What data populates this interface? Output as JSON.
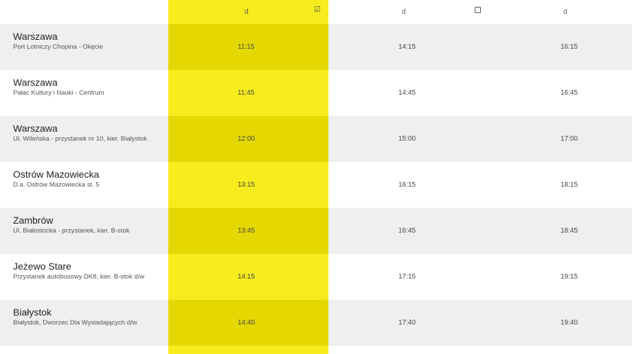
{
  "header": {
    "col1_label": "d",
    "col1_checked": "☑",
    "col2_label": "d",
    "col3_label": "d"
  },
  "stops": [
    {
      "name": "Warszawa",
      "detail": "Port Lotniczy Chopina - Okęcie",
      "times": [
        "11:15",
        "14:15",
        "16:15"
      ]
    },
    {
      "name": "Warszawa",
      "detail": "Pałac Kultury i Nauki - Centrum",
      "times": [
        "11:45",
        "14:45",
        "16:45"
      ]
    },
    {
      "name": "Warszawa",
      "detail": "Ul. Wileńska - przystanek nr 10, kier. Białystok",
      "times": [
        "12:00",
        "15:00",
        "17:00"
      ]
    },
    {
      "name": "Ostrów Mazowiecka",
      "detail": "D.a. Ostrów Mazowiecka st. 5",
      "times": [
        "13:15",
        "16:15",
        "18:15"
      ]
    },
    {
      "name": "Zambrów",
      "detail": "Ul. Białostocka - przystanek, kier. B-stok",
      "times": [
        "13:45",
        "16:45",
        "18:45"
      ]
    },
    {
      "name": "Jeżewo Stare",
      "detail": "Przystanek autobusowy DK8, kier. B-stok d/w",
      "times": [
        "14:15",
        "17:15",
        "19:15"
      ]
    },
    {
      "name": "Białystok",
      "detail": "Białystok, Dworzec Dla Wysiadających d/w",
      "times": [
        "14:40",
        "17:40",
        "19:40"
      ]
    }
  ],
  "colors": {
    "highlight": "#f7ec1e",
    "highlight_alt": "#e5d802",
    "row_alt": "#efefef"
  }
}
